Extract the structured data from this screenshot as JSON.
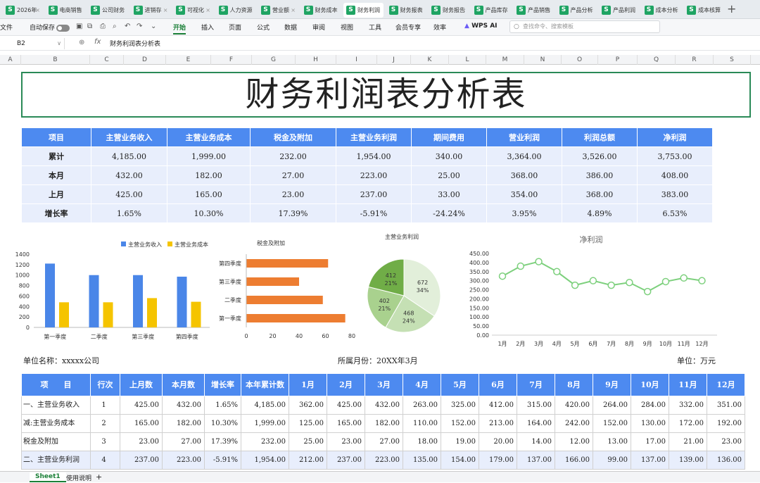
{
  "tabs": [
    {
      "label": "2026年"
    },
    {
      "label": "电商销售"
    },
    {
      "label": "公司财务"
    },
    {
      "label": "进销存"
    },
    {
      "label": "可视化"
    },
    {
      "label": "人力资源"
    },
    {
      "label": "营业额"
    },
    {
      "label": "财务成本"
    },
    {
      "label": "财务利润"
    },
    {
      "label": "财务报表"
    },
    {
      "label": "财务报告"
    },
    {
      "label": "产品库存"
    },
    {
      "label": "产品销售"
    },
    {
      "label": "产品分析"
    },
    {
      "label": "产品利润"
    },
    {
      "label": "成本分析"
    },
    {
      "label": "成本核算"
    }
  ],
  "ribbon": {
    "file": "文件",
    "autosave": "自动保存",
    "menu": [
      "开始",
      "插入",
      "页面",
      "公式",
      "数据",
      "审阅",
      "视图",
      "工具",
      "会员专享",
      "效率"
    ],
    "wps_ai": "WPS AI",
    "search_placeholder": "查找命令、搜索模板"
  },
  "formula": {
    "cell": "B2",
    "fx": "fx",
    "content": "财务利润表分析表"
  },
  "columns": [
    "A",
    "B",
    "C",
    "D",
    "E",
    "F",
    "G",
    "H",
    "I",
    "J",
    "K",
    "L",
    "M",
    "N",
    "O",
    "P",
    "Q",
    "R",
    "S"
  ],
  "title": "财务利润表分析表",
  "summary": {
    "headers": [
      "项目",
      "主营业务收入",
      "主营业务成本",
      "税金及附加",
      "主营业务利润",
      "期间费用",
      "营业利润",
      "利润总额",
      "净利润"
    ],
    "rows": [
      {
        "label": "累计",
        "values": [
          "4,185.00",
          "1,999.00",
          "232.00",
          "1,954.00",
          "340.00",
          "3,364.00",
          "3,526.00",
          "3,753.00"
        ]
      },
      {
        "label": "本月",
        "values": [
          "432.00",
          "182.00",
          "27.00",
          "223.00",
          "25.00",
          "368.00",
          "386.00",
          "408.00"
        ]
      },
      {
        "label": "上月",
        "values": [
          "425.00",
          "165.00",
          "23.00",
          "237.00",
          "33.00",
          "354.00",
          "368.00",
          "383.00"
        ]
      },
      {
        "label": "增长率",
        "values": [
          "1.65%",
          "10.30%",
          "17.39%",
          "-5.91%",
          "-24.24%",
          "3.95%",
          "4.89%",
          "6.53%"
        ]
      }
    ]
  },
  "chart_data": [
    {
      "type": "bar",
      "title": "",
      "categories": [
        "第一季度",
        "二季度",
        "第三季度",
        "第四季度"
      ],
      "series": [
        {
          "name": "主营业务收入",
          "values": [
            1220,
            1000,
            1000,
            970
          ],
          "color": "#4a86e8"
        },
        {
          "name": "主营业务成本",
          "values": [
            480,
            480,
            560,
            490
          ],
          "color": "#f5c400"
        }
      ],
      "yticks": [
        "0",
        "200",
        "400",
        "600",
        "800",
        "1000",
        "1200",
        "1400"
      ],
      "ylim": [
        0,
        1400
      ],
      "legend": "top"
    },
    {
      "type": "bar",
      "orientation": "horizontal",
      "title": "税金及附加",
      "categories": [
        "第四季度",
        "第三季度",
        "二季度",
        "第一季度"
      ],
      "values": [
        62,
        40,
        58,
        75
      ],
      "color": "#ed7d31",
      "xticks": [
        "0",
        "20",
        "40",
        "60",
        "80"
      ],
      "xlim": [
        0,
        80
      ]
    },
    {
      "type": "pie",
      "title": "主营业务利润",
      "slices": [
        {
          "value": 672,
          "pct": "34%",
          "color": "#e2efda"
        },
        {
          "value": 468,
          "pct": "24%",
          "color": "#c5e0b4"
        },
        {
          "value": 402,
          "pct": "21%",
          "color": "#a9d18e"
        },
        {
          "value": 412,
          "pct": "21%",
          "color": "#70ad47"
        }
      ]
    },
    {
      "type": "line",
      "title": "净利润",
      "x": [
        "1月",
        "2月",
        "3月",
        "4月",
        "5月",
        "6月",
        "7月",
        "8月",
        "9月",
        "10月",
        "11月",
        "12月"
      ],
      "values": [
        325,
        380,
        405,
        350,
        275,
        300,
        275,
        290,
        240,
        295,
        315,
        300
      ],
      "color": "#7dd07d",
      "yticks": [
        "0.00",
        "50.00",
        "100.00",
        "150.00",
        "200.00",
        "250.00",
        "300.00",
        "350.00",
        "400.00",
        "450.00"
      ],
      "ylim": [
        0,
        450
      ]
    }
  ],
  "info": {
    "unit": "单位名称：xxxxx公司",
    "month": "所属月份：20XX年3月",
    "money": "单位：万元"
  },
  "detail": {
    "headers": [
      "项　　目",
      "行次",
      "上月数",
      "本月数",
      "增长率",
      "本年累计数",
      "1月",
      "2月",
      "3月",
      "4月",
      "5月",
      "6月",
      "7月",
      "8月",
      "9月",
      "10月",
      "11月",
      "12月"
    ],
    "rows": [
      {
        "name": "一、主营业务收入",
        "line": "1",
        "values": [
          "425.00",
          "432.00",
          "1.65%",
          "4,185.00",
          "362.00",
          "425.00",
          "432.00",
          "263.00",
          "325.00",
          "412.00",
          "315.00",
          "420.00",
          "264.00",
          "284.00",
          "332.00",
          "351.00"
        ]
      },
      {
        "name": "减:主营业务成本",
        "line": "2",
        "values": [
          "165.00",
          "182.00",
          "10.30%",
          "1,999.00",
          "125.00",
          "165.00",
          "182.00",
          "110.00",
          "152.00",
          "213.00",
          "164.00",
          "242.00",
          "152.00",
          "130.00",
          "172.00",
          "192.00"
        ]
      },
      {
        "name": "税金及附加",
        "line": "3",
        "values": [
          "23.00",
          "27.00",
          "17.39%",
          "232.00",
          "25.00",
          "23.00",
          "27.00",
          "18.00",
          "19.00",
          "20.00",
          "14.00",
          "12.00",
          "13.00",
          "17.00",
          "21.00",
          "23.00"
        ]
      },
      {
        "name": "二、主营业务利润",
        "line": "4",
        "values": [
          "237.00",
          "223.00",
          "-5.91%",
          "1,954.00",
          "212.00",
          "237.00",
          "223.00",
          "135.00",
          "154.00",
          "179.00",
          "137.00",
          "166.00",
          "99.00",
          "137.00",
          "139.00",
          "136.00"
        ]
      }
    ]
  },
  "sheets": [
    "Sheet1",
    "使用说明"
  ]
}
